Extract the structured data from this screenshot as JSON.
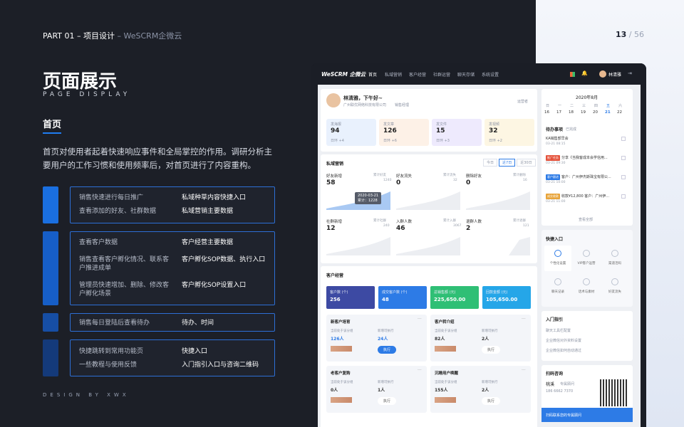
{
  "header": {
    "part": "PART 01 – 项目设计",
    "brand": " – WeSCRM企微云",
    "page": "13",
    "sep": " / ",
    "total": "56"
  },
  "title": {
    "cn": "页面展示",
    "en": "PAGE DISPLAY"
  },
  "section": "首页",
  "description": "首页对使用者起着快速响应事件和全局掌控的作用。调研分析主要用户的工作习惯和使用频率后，对首页进行了内容重构。",
  "groups": [
    {
      "rows": [
        {
          "l": "销售快速进行每日推广",
          "r": "私域种草内容快捷入口"
        },
        {
          "l": "查看添加的好友、社群数据",
          "r": "私域营销主要数据"
        }
      ]
    },
    {
      "rows": [
        {
          "l": "查看客户数据",
          "r": "客户经营主要数据"
        },
        {
          "l": "销售查看客户孵化情况、联系客户推进成单",
          "r": "客户孵化SOP数据、执行入口"
        },
        {
          "l": "管理员快速增加、删除、修改客户孵化场景",
          "r": "客户孵化SOP设置入口"
        }
      ]
    },
    {
      "rows": [
        {
          "l": "销售每日登陆后查看待办",
          "r": "待办、时间"
        }
      ]
    },
    {
      "rows": [
        {
          "l": "快捷跳转到常用功能页",
          "r": "快捷入口"
        },
        {
          "l": "一些教程与使用反馈",
          "r": "入门指引入口与咨询二维码"
        }
      ]
    }
  ],
  "footer": "DESIGN BY XWX",
  "app": {
    "logo": "WeSCRM 企微云",
    "nav": [
      "首页",
      "私域营销",
      "客户经营",
      "社群运营",
      "聊天存储",
      "系统设置"
    ],
    "user": "林清雅",
    "greeting": "林清雅，下午好~",
    "company": "广州联优网络科技有限公司",
    "dept": "销售经理",
    "role": "运营者",
    "tiles": [
      {
        "label": "发海报",
        "value": "94",
        "delta": "日环 +4",
        "color": "#e9f1fd"
      },
      {
        "label": "发文章",
        "value": "126",
        "delta": "日环 +6",
        "color": "#fdf1e7"
      },
      {
        "label": "发文件",
        "value": "15",
        "delta": "日环 +3",
        "color": "#eeeafd"
      },
      {
        "label": "发视频",
        "value": "32",
        "delta": "日环 +2",
        "color": "#fdf6e3"
      }
    ],
    "private": {
      "title": "私域营销",
      "tabs": [
        "今日",
        "近7日",
        "近30日"
      ],
      "stats": [
        {
          "label": "好友新增",
          "value": "58",
          "total": "累计好友",
          "tot": "1240"
        },
        {
          "label": "好友流失",
          "value": "0",
          "total": "累计流失",
          "tot": "32"
        },
        {
          "label": "删除好友",
          "value": "0",
          "total": "累计删除",
          "tot": "16"
        },
        {
          "label": "社群新增",
          "value": "12",
          "total": "累计社群",
          "tot": "240"
        },
        {
          "label": "入群人数",
          "value": "46",
          "total": "累计入群",
          "tot": "3067"
        },
        {
          "label": "退群人数",
          "value": "2",
          "total": "累计退群",
          "tot": "121"
        }
      ],
      "tooltip": {
        "date": "2020-03-21",
        "text": "累计：1228"
      }
    },
    "customer": {
      "title": "客户经营",
      "blocks": [
        {
          "label": "客户数 (个)",
          "value": "256",
          "color": "#3d4aa3"
        },
        {
          "label": "成交客户数 (个)",
          "value": "48",
          "color": "#2d7be6"
        },
        {
          "label": "总销售额 (元)",
          "value": "225,650.00",
          "color": "#2fbf75"
        },
        {
          "label": "回款金额 (元)",
          "value": "105,650.00",
          "color": "#25a6e8"
        }
      ],
      "cards": [
        {
          "title": "新客户培育",
          "a": "当前处于该分组",
          "av": "126人",
          "b": "新增可执行",
          "bv": "24人",
          "btn": "执行"
        },
        {
          "title": "客户转介绍",
          "a": "当前处于该分组",
          "av": "82人",
          "b": "新增可执行",
          "bv": "2人",
          "btn": "执行"
        },
        {
          "title": "老客户复购",
          "a": "当前处于该分组",
          "av": "0人",
          "b": "新增可执行",
          "bv": "1人",
          "btn": "执行"
        },
        {
          "title": "沉睡用户唤醒",
          "a": "当前处于该分组",
          "av": "155人",
          "b": "新增可执行",
          "bv": "2人",
          "btn": "执行"
        }
      ]
    },
    "calendar": {
      "month": "2020年8月",
      "days": [
        "日",
        "一",
        "二",
        "三",
        "四",
        "五",
        "六"
      ],
      "dates": [
        "16",
        "17",
        "18",
        "19",
        "20",
        "21",
        "22"
      ]
    },
    "todo": {
      "title": "待办事项",
      "done": "已完成",
      "more": "查看全部",
      "items": [
        {
          "tag": "",
          "text": "KA销售部早会",
          "time": "03-21 08:15"
        },
        {
          "tag": "推广任务",
          "text": "分享《当我客成本会学信用...",
          "time": "03-21 09:30"
        },
        {
          "tag": "客户跟进",
          "text": "客户：广州伊杰斯珠宝有限公...",
          "time": "03-21 10:00"
        },
        {
          "tag": "成交收款",
          "text": "收款¥12,800 客户：广州伊...",
          "time": "03-21 11:00"
        }
      ]
    },
    "quick": {
      "title": "快捷入口",
      "items": [
        "个性化设置",
        "VIP客户运营",
        "渠道活码",
        "聊天记录",
        "话术与素材",
        "好友流失"
      ]
    },
    "guide": {
      "title": "入门指引",
      "items": [
        "聊天工具栏配置",
        "企业微信对外资料设置",
        "企业微信如何自动通过"
      ]
    },
    "consult": {
      "title": "扫码咨询",
      "name": "桃溪",
      "role": "专属顾问",
      "phone": "186 6662 7370",
      "btn": "扫码联系您的专属顾问"
    }
  }
}
